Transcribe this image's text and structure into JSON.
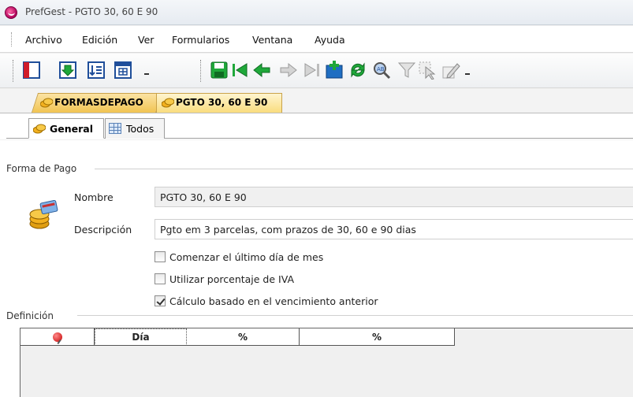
{
  "window": {
    "title": "PrefGest - PGTO 30, 60 E 90"
  },
  "menu": {
    "items": [
      "Archivo",
      "Edición",
      "Ver",
      "Formularios",
      "Ventana",
      "Ayuda"
    ]
  },
  "toolbar": {
    "left_icons": [
      "new-form-icon",
      "import-icon",
      "sort-icon",
      "table-icon"
    ],
    "right_icons": [
      "save-icon",
      "first-record-icon",
      "previous-record-icon",
      "next-record-icon",
      "last-record-icon",
      "add-record-icon",
      "refresh-icon",
      "find-icon",
      "filter-icon",
      "select-icon",
      "edit-icon"
    ]
  },
  "document_tabs": [
    {
      "label": "FORMASDEPAGO",
      "active": false
    },
    {
      "label": "PGTO 30, 60 E 90",
      "active": true
    }
  ],
  "inner_tabs": [
    {
      "label": "General",
      "active": true
    },
    {
      "label": "Todos",
      "active": false
    }
  ],
  "form": {
    "group_title": "Forma de Pago",
    "nombre_label": "Nombre",
    "nombre_value": "PGTO 30, 60 E 90",
    "descripcion_label": "Descripción",
    "descripcion_value": "Pgto em 3 parcelas, com prazos de 30, 60 e 90 dias",
    "checks": [
      {
        "label": "Comenzar el último día de mes",
        "checked": false
      },
      {
        "label": "Utilizar porcentaje de IVA",
        "checked": false
      },
      {
        "label": "Cálculo basado en el vencimiento anterior",
        "checked": true
      }
    ]
  },
  "definicion": {
    "group_title": "Definición",
    "columns": [
      "Día",
      "%",
      "%"
    ]
  },
  "colors": {
    "accent_tab": "#f1c452",
    "toolbar_green": "#1fa83a"
  }
}
